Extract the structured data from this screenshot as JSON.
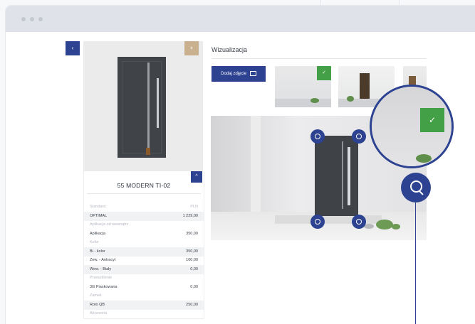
{
  "colors": {
    "accent": "#2d4391",
    "success": "#43a047",
    "gold": "#c9b08f",
    "window_bar": "#dfe2e8"
  },
  "product": {
    "prev_icon": "‹",
    "add_icon": "+",
    "collapse_icon": "^",
    "name": "55 MODERN TI-02",
    "options": [
      {
        "kind": "section",
        "label": "Standard",
        "value": "PLN"
      },
      {
        "kind": "item",
        "label": "OPTIMAL",
        "value": "1 229,00"
      },
      {
        "kind": "section",
        "label": "Aplikacja od wewnątrz",
        "value": ""
      },
      {
        "kind": "item",
        "label": "Aplikacja",
        "value": "350,00"
      },
      {
        "kind": "section",
        "label": "Kolor",
        "value": ""
      },
      {
        "kind": "item",
        "label": "Bi - kolor",
        "value": "350,00"
      },
      {
        "kind": "item",
        "label": "Zew. - Antracyt",
        "value": "100,00"
      },
      {
        "kind": "item",
        "label": "Wew. - Biały",
        "value": "0,00"
      },
      {
        "kind": "section",
        "label": "Przeszklenie",
        "value": ""
      },
      {
        "kind": "item",
        "label": "3G Piaskowana",
        "value": "0,00"
      },
      {
        "kind": "section",
        "label": "Zamek",
        "value": ""
      },
      {
        "kind": "item",
        "label": "Roto QB",
        "value": "250,00"
      },
      {
        "kind": "section",
        "label": "Akcesoria",
        "value": ""
      }
    ]
  },
  "visualization": {
    "title": "Wizualizacja",
    "add_photo_label": "Dodaj zdjęcie",
    "check_icon": "✓",
    "icons": [
      "camera-icon",
      "check-icon",
      "search-icon",
      "corner-handle-icon"
    ]
  }
}
